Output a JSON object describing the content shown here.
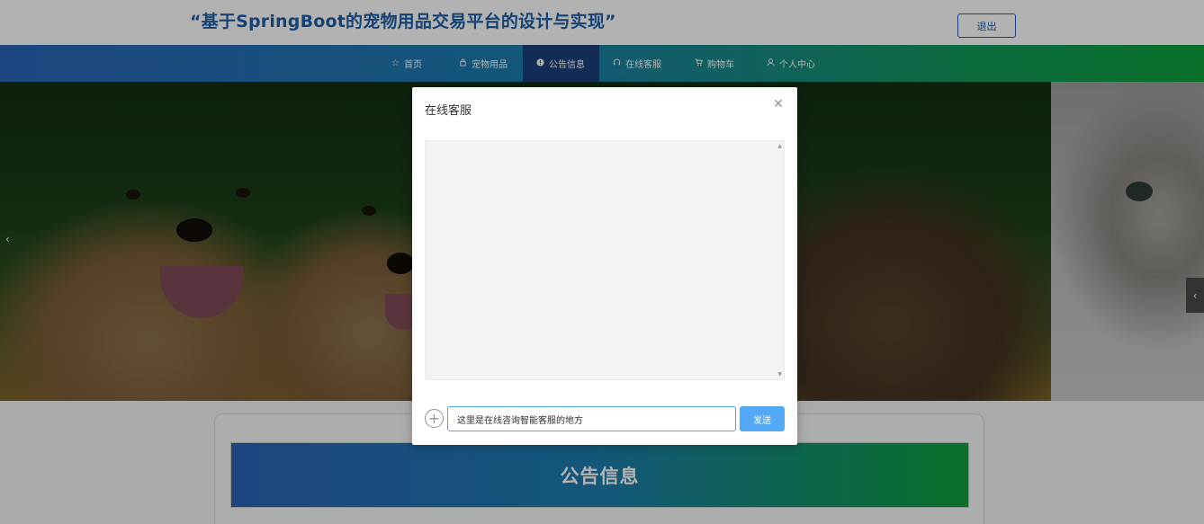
{
  "header": {
    "site_title": "“基于SpringBoot的宠物用品交易平台的设计与实现”",
    "logout_label": "退出"
  },
  "nav": {
    "items": [
      {
        "label": "首页",
        "icon": "star-icon"
      },
      {
        "label": "宠物用品",
        "icon": "bag-icon"
      },
      {
        "label": "公告信息",
        "icon": "info-icon"
      },
      {
        "label": "在线客服",
        "icon": "headset-icon"
      },
      {
        "label": "购物车",
        "icon": "cart-icon"
      },
      {
        "label": "个人中心",
        "icon": "user-icon"
      }
    ],
    "active": "公告信息"
  },
  "section": {
    "notice_title": "公告信息"
  },
  "dialog": {
    "title": "在线客服",
    "input_value": "这里是在线咨询智能客服的地方",
    "send_label": "发送"
  },
  "colors": {
    "brand_blue": "#1f5fa8",
    "nav_active": "#1b3f7a",
    "send_button": "#53a9f5",
    "nav_gradient_end": "#0ea03c"
  }
}
